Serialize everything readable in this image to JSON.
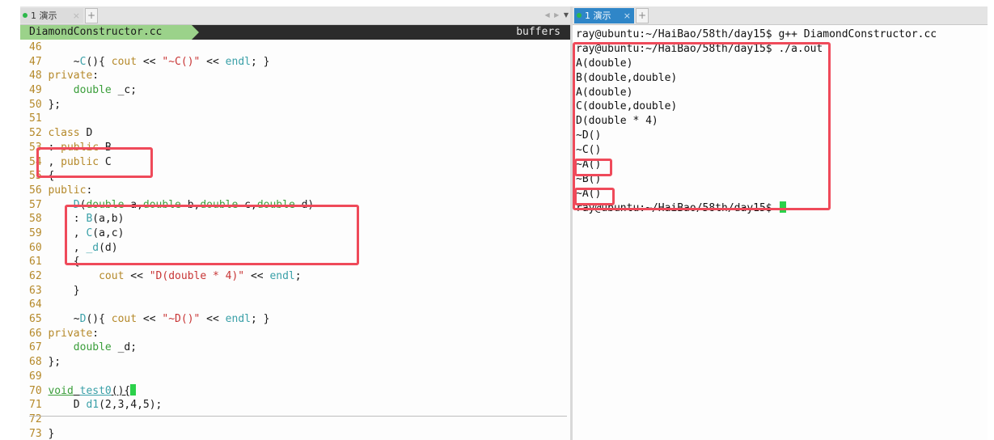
{
  "colors": {
    "highlight": "#ef4a5a",
    "tab_active": "#2f86c8",
    "modeline_file": "#9bd28a",
    "cursor": "#2bd14a",
    "keyword": "#b5892a",
    "type": "#3a9e3a",
    "function": "#3aa0a8",
    "string": "#c83535"
  },
  "left_tabbar": {
    "tab_label": "1 演示",
    "close": "×",
    "add": "+",
    "nav_prev": "◀",
    "nav_next": "▶",
    "nav_menu": "▼"
  },
  "right_tabbar": {
    "tab_label": "1 演示",
    "close": "×",
    "add": "+"
  },
  "editor": {
    "filename": "DiamondConstructor.cc",
    "buffers_label": "buffers",
    "lines": [
      {
        "n": "46",
        "parts": []
      },
      {
        "n": "47",
        "parts": [
          {
            "t": "    ~"
          },
          {
            "t": "C",
            "c": "fn"
          },
          {
            "t": "(){ "
          },
          {
            "t": "cout",
            "c": "kw"
          },
          {
            "t": " << "
          },
          {
            "t": "\"~C()\"",
            "c": "st"
          },
          {
            "t": " << "
          },
          {
            "t": "endl",
            "c": "fn"
          },
          {
            "t": "; }"
          }
        ]
      },
      {
        "n": "48",
        "parts": [
          {
            "t": "private",
            "c": "kw"
          },
          {
            "t": ":"
          }
        ]
      },
      {
        "n": "49",
        "parts": [
          {
            "t": "    "
          },
          {
            "t": "double",
            "c": "ty"
          },
          {
            "t": " _c;"
          }
        ]
      },
      {
        "n": "50",
        "parts": [
          {
            "t": "};"
          }
        ]
      },
      {
        "n": "51",
        "parts": []
      },
      {
        "n": "52",
        "parts": [
          {
            "t": "class",
            "c": "kw"
          },
          {
            "t": " D"
          }
        ]
      },
      {
        "n": "53",
        "parts": [
          {
            "t": ": "
          },
          {
            "t": "public",
            "c": "kw"
          },
          {
            "t": " B"
          }
        ]
      },
      {
        "n": "54",
        "parts": [
          {
            "t": ", "
          },
          {
            "t": "public",
            "c": "kw"
          },
          {
            "t": " C"
          }
        ]
      },
      {
        "n": "55",
        "parts": [
          {
            "t": "{"
          }
        ]
      },
      {
        "n": "56",
        "parts": [
          {
            "t": "public",
            "c": "kw"
          },
          {
            "t": ":"
          }
        ]
      },
      {
        "n": "57",
        "parts": [
          {
            "t": "    "
          },
          {
            "t": "D",
            "c": "fn"
          },
          {
            "t": "("
          },
          {
            "t": "double",
            "c": "ty"
          },
          {
            "t": " a,"
          },
          {
            "t": "double",
            "c": "ty"
          },
          {
            "t": " b,"
          },
          {
            "t": "double",
            "c": "ty"
          },
          {
            "t": " c,"
          },
          {
            "t": "double",
            "c": "ty"
          },
          {
            "t": " d)"
          }
        ]
      },
      {
        "n": "58",
        "parts": [
          {
            "t": "    : "
          },
          {
            "t": "B",
            "c": "fn"
          },
          {
            "t": "(a,b)"
          }
        ]
      },
      {
        "n": "59",
        "parts": [
          {
            "t": "    , "
          },
          {
            "t": "C",
            "c": "fn"
          },
          {
            "t": "(a,c)"
          }
        ]
      },
      {
        "n": "60",
        "parts": [
          {
            "t": "    , "
          },
          {
            "t": "_d",
            "c": "fn"
          },
          {
            "t": "(d)"
          }
        ]
      },
      {
        "n": "61",
        "parts": [
          {
            "t": "    {"
          }
        ]
      },
      {
        "n": "62",
        "parts": [
          {
            "t": "        "
          },
          {
            "t": "cout",
            "c": "kw"
          },
          {
            "t": " << "
          },
          {
            "t": "\"D(double * 4)\"",
            "c": "st"
          },
          {
            "t": " << "
          },
          {
            "t": "endl",
            "c": "fn"
          },
          {
            "t": ";"
          }
        ]
      },
      {
        "n": "63",
        "parts": [
          {
            "t": "    }"
          }
        ]
      },
      {
        "n": "64",
        "parts": []
      },
      {
        "n": "65",
        "parts": [
          {
            "t": "    ~"
          },
          {
            "t": "D",
            "c": "fn"
          },
          {
            "t": "(){ "
          },
          {
            "t": "cout",
            "c": "kw"
          },
          {
            "t": " << "
          },
          {
            "t": "\"~D()\"",
            "c": "st"
          },
          {
            "t": " << "
          },
          {
            "t": "endl",
            "c": "fn"
          },
          {
            "t": "; }"
          }
        ]
      },
      {
        "n": "66",
        "parts": [
          {
            "t": "private",
            "c": "kw"
          },
          {
            "t": ":"
          }
        ]
      },
      {
        "n": "67",
        "parts": [
          {
            "t": "    "
          },
          {
            "t": "double",
            "c": "ty"
          },
          {
            "t": " _d;"
          }
        ]
      },
      {
        "n": "68",
        "parts": [
          {
            "t": "};"
          }
        ]
      },
      {
        "n": "69",
        "parts": []
      },
      {
        "n": "70",
        "parts": [
          {
            "t": "void",
            "c": "ty ul"
          },
          {
            "t": " ",
            "c": "ul"
          },
          {
            "t": "test0",
            "c": "fn ul"
          },
          {
            "t": "(){",
            "c": "ul"
          },
          {
            "t": "",
            "c": "cur"
          }
        ]
      },
      {
        "n": "71",
        "parts": [
          {
            "t": "    D "
          },
          {
            "t": "d1",
            "c": "fn"
          },
          {
            "t": "(2,3,4,5);"
          }
        ]
      },
      {
        "n": "72",
        "parts": []
      },
      {
        "n": "73",
        "parts": [
          {
            "t": "}"
          }
        ]
      }
    ]
  },
  "terminal": {
    "lines": [
      "ray@ubuntu:~/HaiBao/58th/day15$ g++ DiamondConstructor.cc",
      "ray@ubuntu:~/HaiBao/58th/day15$ ./a.out",
      "A(double)",
      "B(double,double)",
      "A(double)",
      "C(double,double)",
      "D(double * 4)",
      "~D()",
      "~C()",
      "~A()",
      "~B()",
      "~A()",
      "ray@ubuntu:~/HaiBao/58th/day15$ "
    ]
  }
}
